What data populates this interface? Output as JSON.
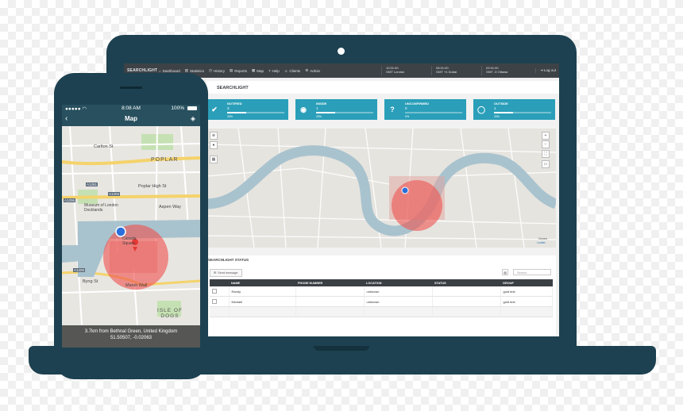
{
  "laptop": {
    "app": {
      "logo": "SEARCHLIGHT",
      "nav": [
        {
          "icon": "home-icon",
          "label": "Dashboard"
        },
        {
          "icon": "chart-icon",
          "label": "Statistics"
        },
        {
          "icon": "clock-icon",
          "label": "History"
        },
        {
          "icon": "report-icon",
          "label": "Reports"
        },
        {
          "icon": "map-icon",
          "label": "Map"
        },
        {
          "icon": "help-icon",
          "label": "Help"
        },
        {
          "icon": "clients-icon",
          "label": "Clients"
        },
        {
          "icon": "admin-icon",
          "label": "Admin"
        }
      ],
      "clocks": [
        {
          "time": "10:31:00",
          "zone": "GMT London"
        },
        {
          "time": "08:31:00",
          "zone": "GMT +4 Dubai"
        },
        {
          "time": "03:31:00",
          "zone": "GMT -5 Ottawa"
        }
      ],
      "logout": "Log out"
    },
    "page_title": "SEARCHLIGHT",
    "cards": [
      {
        "label": "NOTIFIED",
        "value": "3",
        "percent": "33%",
        "fill": 0.33,
        "icon": "check-icon",
        "glyph": "✔"
      },
      {
        "label": "INSIDE",
        "value": "1",
        "percent": "33%",
        "fill": 0.33,
        "icon": "target-icon",
        "glyph": "◉"
      },
      {
        "label": "UNCONFIRMED",
        "value": "0",
        "percent": "0%",
        "fill": 0.0,
        "icon": "question-icon",
        "glyph": "?"
      },
      {
        "label": "OUTSIDE",
        "value": "1",
        "percent": "33%",
        "fill": 0.33,
        "icon": "circle-icon",
        "glyph": "◯"
      }
    ],
    "map": {
      "attribution": "Leaflet",
      "place": "Green",
      "controls": [
        "+",
        "−"
      ]
    },
    "status": {
      "title": "SEARCHLIGHT STATUS",
      "send_label": "Send message",
      "search_placeholder": "Search...",
      "columns": [
        "NAME",
        "PHONE NUMBER",
        "LOCATION",
        "STATUS",
        "GROUP"
      ],
      "rows": [
        {
          "name": "Randy",
          "phone": "",
          "location": "unknown",
          "status": "",
          "group": "gold test"
        },
        {
          "name": "Michael",
          "phone": "",
          "location": "unknown",
          "status": "",
          "group": "gold test"
        },
        {
          "name": "",
          "phone": "",
          "location": "",
          "status": "",
          "group": ""
        }
      ]
    }
  },
  "phone": {
    "status_bar": {
      "time": "8:08 AM",
      "battery": "100%"
    },
    "title": "Map",
    "map_labels": {
      "carlton": "Carlton St",
      "poplar": "POPLAR",
      "poplar_high": "Poplar High St",
      "aspen": "Aspen Way",
      "museum": "Museum of London Docklands",
      "square": "Canada Square",
      "byng": "Byng St",
      "marsh": "Marsh Wall",
      "isle": "ISLE OF DOGS",
      "a1261": "A1261",
      "a1203": "A1203",
      "a1206_a": "A1206",
      "a1206_b": "A1206"
    },
    "footer": {
      "line1": "3.7km from Bethnal Green, United Kingdom",
      "line2": "51.50507, -0.02063"
    }
  },
  "colors": {
    "device": "#1d4150",
    "accent": "#2b9fb9",
    "geofence": "#ef5350",
    "marker": "#2a6fdb"
  }
}
